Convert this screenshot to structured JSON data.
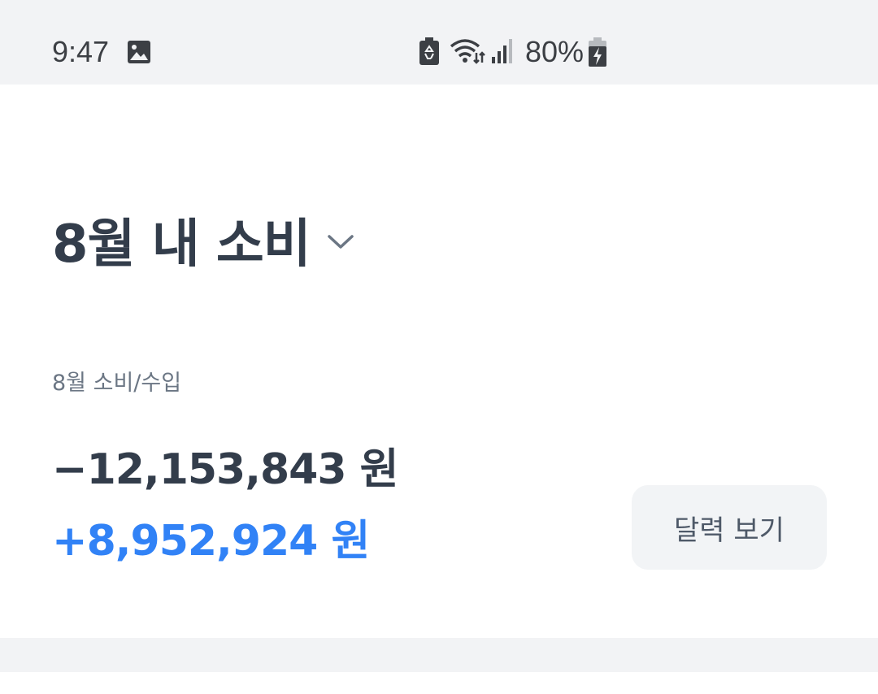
{
  "status_bar": {
    "time": "9:47",
    "battery_percent": "80%",
    "icons": [
      "gallery-icon",
      "recycle-icon",
      "wifi-icon",
      "signal-icon",
      "battery-charging-icon"
    ]
  },
  "header": {
    "title": "8월 내 소비",
    "dropdown_icon": "chevron-down-icon"
  },
  "summary": {
    "label": "8월 소비/수입",
    "expense": "−12,153,843 원",
    "income": "+8,952,924 원",
    "calendar_button_label": "달력 보기"
  },
  "colors": {
    "primary_text": "#333d4b",
    "secondary_text": "#6b7684",
    "income_blue": "#3182f6",
    "button_bg": "#f2f4f6",
    "status_bar_bg": "#f2f3f5"
  }
}
